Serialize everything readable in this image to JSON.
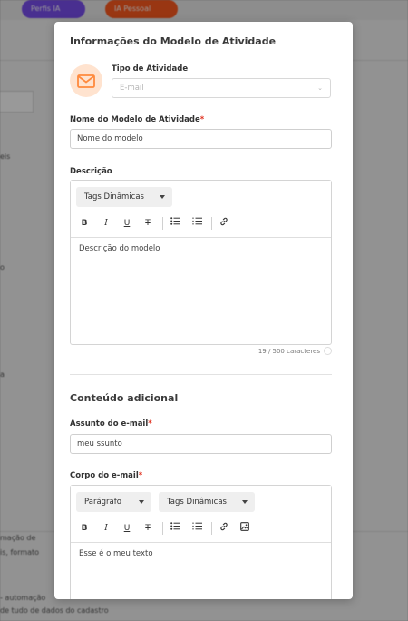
{
  "background": {
    "pill_1": "Perfis IA",
    "pill_2": "IA Pessoal",
    "snippets": [
      "eis",
      "o",
      "a",
      "mação de",
      "is, formato",
      "- automação",
      "de tudo de dados do cadastro"
    ]
  },
  "modal": {
    "title": "Informações do Modelo de Atividade",
    "activity_type": {
      "label": "Tipo de Atividade",
      "value": "E-mail",
      "icon": "envelope-icon"
    },
    "model_name": {
      "label": "Nome do Modelo de Atividade",
      "required": "*",
      "value": "Nome do modelo"
    },
    "description": {
      "label": "Descrição",
      "tags_label": "Tags Dinâmicas",
      "text": "Descrição do modelo",
      "counter": "19 / 500 caracteres"
    },
    "additional_section": "Conteúdo adicional",
    "subject": {
      "label": "Assunto do e-mail",
      "required": "*",
      "value": "meu ssunto"
    },
    "body": {
      "label": "Corpo do e-mail",
      "required": "*",
      "paragraph_label": "Parágrafo",
      "tags_label": "Tags Dinâmicas",
      "text": "Esse é o meu texto"
    },
    "toolbar": {
      "bold": "B",
      "italic": "I",
      "underline": "U",
      "strike": "T"
    }
  },
  "colors": {
    "accent": "#ff8a3d",
    "avatar_bg": "#ffe3cf",
    "required": "#e0301e"
  }
}
